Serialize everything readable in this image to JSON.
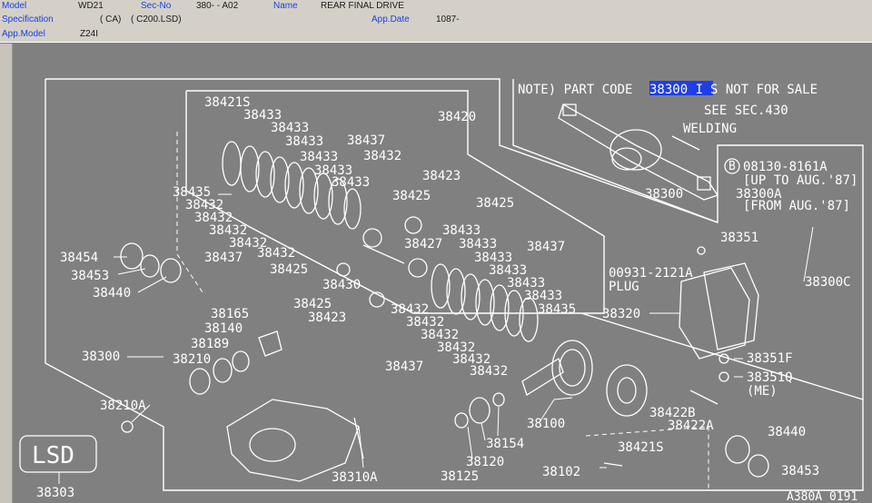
{
  "header": {
    "model_label": "Model",
    "model_value": "WD21",
    "secno_label": "Sec-No",
    "secno_value": "380-  - A02",
    "name_label": "Name",
    "name_value": "REAR FINAL DRIVE",
    "spec_label": "Specification",
    "spec_value1": "( CA)",
    "spec_value2": "( C200.LSD)",
    "appdate_label": "App.Date",
    "appdate_value": "1087-",
    "appmodel_label": "App.Model",
    "appmodel_value": "Z24I"
  },
  "diagram": {
    "note_prefix": "NOTE) PART CODE ",
    "note_code": "38300 I",
    "note_suffix": "S NOT FOR SALE",
    "see_sec": "SEE SEC.430",
    "welding": "WELDING",
    "bolt_code": "08130-8161A",
    "bolt_upto": "[UP TO AUG.'87]",
    "bolt_alt": "38300A",
    "bolt_from": "[FROM AUG.'87]",
    "plug_code": "00931-2121A",
    "plug_label": "PLUG",
    "me_label": "(ME)",
    "lsd_label": "LSD",
    "ref": "A380A 0191",
    "parts": {
      "p38421S_top": "38421S",
      "p38433_a": "38433",
      "p38433_b": "38433",
      "p38433_c": "38433",
      "p38437_a": "38437",
      "p38433_d": "38433",
      "p38432_a": "38432",
      "p38433_e": "38433",
      "p38433_f": "38433",
      "p38420": "38420",
      "p38423_a": "38423",
      "p38435_a": "38435",
      "p38425_a": "38425",
      "p38432_b": "38432",
      "p38432_c": "38432",
      "p38432_d": "38432",
      "p38432_e": "38432",
      "p38432_f": "38432",
      "p38425_b": "38425",
      "p38433_g": "38433",
      "p38437_b": "38437",
      "p38427": "38427",
      "p38433_h": "38433",
      "p38454": "38454",
      "p38437_c": "38437",
      "p38433_i": "38433",
      "p38453_a": "38453",
      "p38425_c": "38425",
      "p38433_j": "38433",
      "p38440_a": "38440",
      "p38430": "38430",
      "p38433_k": "38433",
      "p38425_d": "38425",
      "p38432_g": "38432",
      "p38433_l": "38433",
      "p38423_b": "38423",
      "p38432_h": "38432",
      "p38435_b": "38435",
      "p38165": "38165",
      "p38432_i": "38432",
      "p38140": "38140",
      "p38432_j": "38432",
      "p38189": "38189",
      "p38300_left": "38300",
      "p38432_k": "38432",
      "p38432_l": "38432",
      "p38210": "38210",
      "p38437_d": "38437",
      "p38210A": "38210A",
      "p38300_right": "38300",
      "p38351": "38351",
      "p38300C": "38300C",
      "p38320": "38320",
      "p38351F": "38351F",
      "p38351Q": "38351Q",
      "p38422B": "38422B",
      "p38422A": "38422A",
      "p38100": "38100",
      "p38440_b": "38440",
      "p38154": "38154",
      "p38421S_bot": "38421S",
      "p38120": "38120",
      "p38453_b": "38453",
      "p38310A": "38310A",
      "p38125": "38125",
      "p38102": "38102",
      "p38303": "38303"
    }
  }
}
